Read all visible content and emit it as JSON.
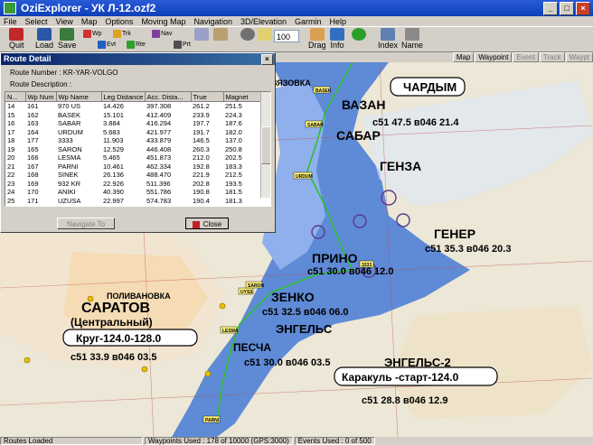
{
  "window": {
    "title": "OziExplorer - УК Л-12.ozf2"
  },
  "menu": [
    "File",
    "Select",
    "View",
    "Map",
    "Options",
    "Moving Map",
    "Navigation",
    "3D/Elevation",
    "Garmin",
    "Help"
  ],
  "toolbar": {
    "quit": "Quit",
    "load": "Load",
    "save": "Save",
    "small": [
      "Wp",
      "Evt",
      "Trk",
      "Rte",
      "Nav",
      "Prt"
    ],
    "zoom": "100",
    "drag": "Drag",
    "info": "Info",
    "index": "Index",
    "name": "Name"
  },
  "map_tabs": [
    "Map",
    "Waypoint",
    "Event",
    "Track",
    "Waypt"
  ],
  "dialog": {
    "title": "Route Detail",
    "route_number": "Route Number : KR-YAR-VOLGO",
    "route_description": "Route Description :",
    "columns": [
      "N...",
      "Wp Num",
      "Wp Name",
      "Leg Distance",
      "Acc. Dista...",
      "True",
      "Magnet"
    ],
    "rows": [
      [
        "14",
        "161",
        "970 US",
        "14.426",
        "397.308",
        "261.2",
        "251.5"
      ],
      [
        "15",
        "162",
        "BASEK",
        "15.101",
        "412.409",
        "233.9",
        "224.3"
      ],
      [
        "16",
        "163",
        "SABAR",
        "3.884",
        "416.294",
        "197.7",
        "187.6"
      ],
      [
        "17",
        "164",
        "URDUM",
        "5.683",
        "421.977",
        "191.7",
        "182.0"
      ],
      [
        "18",
        "177",
        "3333",
        "11.903",
        "433.879",
        "146.5",
        "137.0"
      ],
      [
        "19",
        "165",
        "SARON",
        "12.529",
        "446.408",
        "260.3",
        "250.8"
      ],
      [
        "20",
        "166",
        "LESMA",
        "5.465",
        "451.873",
        "212.0",
        "202.5"
      ],
      [
        "21",
        "167",
        "PARNI",
        "10.461",
        "462.334",
        "192.8",
        "183.3"
      ],
      [
        "22",
        "168",
        "SINEK",
        "26.136",
        "488.470",
        "221.9",
        "212.5"
      ],
      [
        "23",
        "169",
        "932 KR",
        "22.926",
        "511.396",
        "202.8",
        "193.5"
      ],
      [
        "24",
        "170",
        "ANIKI",
        "40.390",
        "551.786",
        "190.8",
        "181.5"
      ],
      [
        "25",
        "171",
        "UZUSA",
        "22.997",
        "574.783",
        "190.4",
        "181.3"
      ]
    ],
    "navigate_btn": "Navigate To",
    "close_btn": "Close"
  },
  "map": {
    "labels": [
      "ЧАРДЫМ",
      "ВАЗАН",
      "САБАР",
      "ГЕНЗА",
      "ГЕНЕР",
      "ПРИНО",
      "ЗЕНКО",
      "ЭНГЕЛЬС",
      "САРАТОВ",
      "(Центральный)",
      "Круг-124.0-128.0",
      "ЭНГЕЛЬС-2",
      "Каракуль -старт-124.0",
      "ВЯЗОВКА",
      "ПОЛИВАНОВКА",
      "ПЕСЧА"
    ],
    "freqs": [
      "с51 47.5 в046 21.4",
      "с51 35.3 в046 20.3",
      "с51 30.0 в046 12.0",
      "с51 32.5 в046 06.0",
      "с51 33.9 в046 03.5",
      "с51 28.8 в046 12.9",
      "с51 30.0 в046 03.5"
    ],
    "waypoints": [
      "BASEK",
      "SABAR",
      "URDUM",
      "UYSS",
      "3333",
      "SARON",
      "LESMA",
      "PARNI"
    ]
  },
  "status": {
    "routes": "Routes Loaded",
    "waypoints": "Waypoints Used : 178 of 10000   (GPS:3000)",
    "events": "Events Used : 0 of 500"
  }
}
